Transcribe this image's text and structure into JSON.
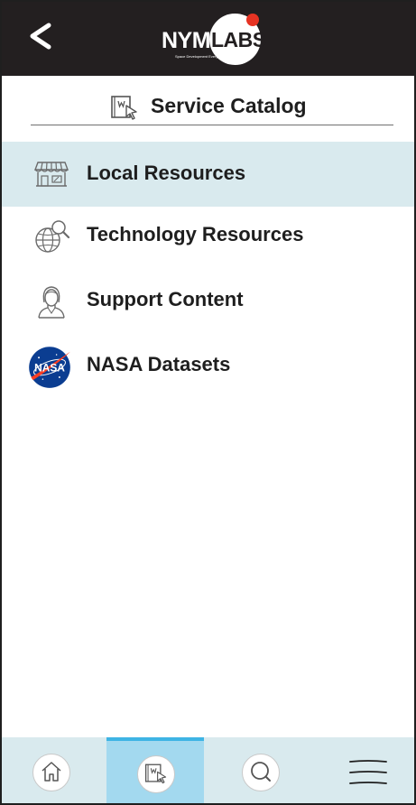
{
  "header": {
    "logo_primary": "NYM",
    "logo_secondary": "LABS",
    "logo_tagline": "Space Development Everywhere"
  },
  "catalog": {
    "title": "Service Catalog",
    "icon": "catalog-icon"
  },
  "menu": [
    {
      "label": "Local Resources",
      "icon": "storefront-icon",
      "selected": true
    },
    {
      "label": "Technology Resources",
      "icon": "globe-search-icon",
      "selected": false
    },
    {
      "label": "Support Content",
      "icon": "support-person-icon",
      "selected": false
    },
    {
      "label": "NASA Datasets",
      "icon": "nasa-logo-icon",
      "selected": false
    }
  ],
  "bottom_nav": [
    {
      "icon": "home-icon",
      "active": false
    },
    {
      "icon": "catalog-icon",
      "active": true
    },
    {
      "icon": "search-icon",
      "active": false
    },
    {
      "icon": "hamburger-menu-icon",
      "active": false
    }
  ],
  "colors": {
    "topbar": "#231f20",
    "selected_row": "#d9eaee",
    "active_nav": "#a3d9ef",
    "active_nav_border": "#3eb4e4",
    "logo_accent": "#e63323",
    "nasa_blue": "#0b3d91",
    "nasa_red": "#fc3d21"
  }
}
